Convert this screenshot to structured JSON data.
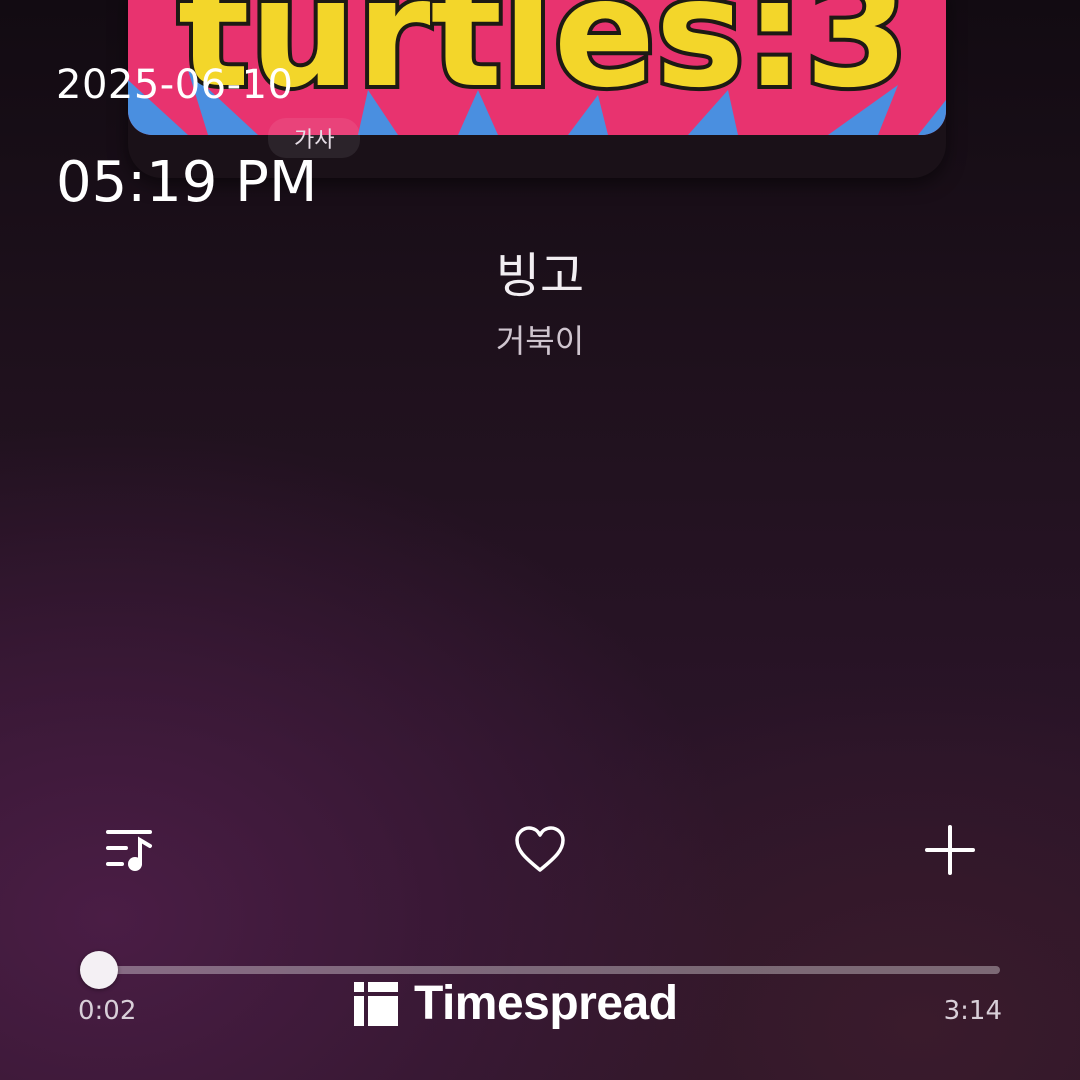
{
  "overlay": {
    "date": "2025-06-10",
    "time": "05:19 PM"
  },
  "album": {
    "lyrics_label": "가사",
    "art_text": "turtles:3"
  },
  "track": {
    "title": "빙고",
    "artist": "거북이"
  },
  "controls": {
    "playlist_icon": "playlist-music-icon",
    "like_icon": "heart-outline-icon",
    "add_icon": "plus-icon"
  },
  "progress": {
    "elapsed": "0:02",
    "duration": "3:14",
    "elapsed_seconds": 2,
    "duration_seconds": 194
  },
  "watermark": {
    "text": "Timespread"
  },
  "colors": {
    "accent": "#ffffff",
    "track": "#8a7a8a"
  }
}
